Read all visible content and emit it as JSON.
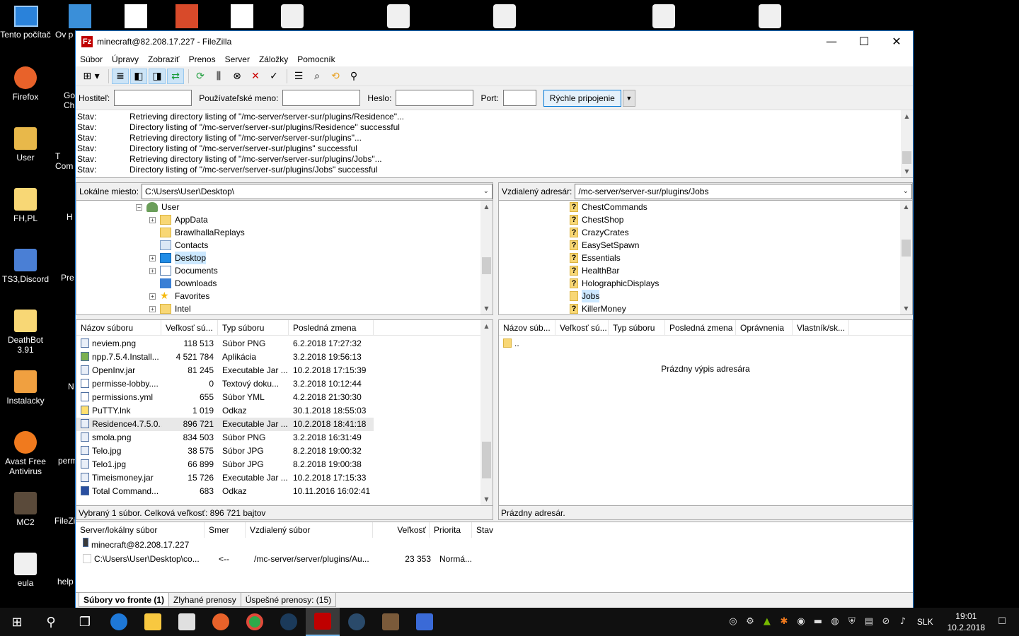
{
  "desktop": {
    "icons": [
      {
        "label": "Tento počítač",
        "color": "#4a90d9"
      },
      {
        "label": "Firefox",
        "color": "#e8622a"
      },
      {
        "label": "User",
        "color": "#e8b84a"
      },
      {
        "label": "FH,PL",
        "color": "#f8d775"
      },
      {
        "label": "TS3,Discord",
        "color": "#4a7fd5"
      },
      {
        "label": "DeathBot 3.91",
        "color": "#f8d775"
      },
      {
        "label": "Instalacky",
        "color": "#f0a040"
      },
      {
        "label": "Avast Free Antivirus",
        "color": "#f07a1e"
      },
      {
        "label": "MC2",
        "color": "#5a4a3a"
      },
      {
        "label": "eula",
        "color": "#f0f0f0"
      }
    ],
    "partial_labels": [
      "Ov p",
      "Go Ch",
      "T Com",
      "H",
      "Pre",
      "N",
      "perm",
      "FileZi",
      "help"
    ]
  },
  "window": {
    "title": "minecraft@82.208.17.227 - FileZilla",
    "app_icon": "Fz",
    "controls": {
      "minimize": "—",
      "maximize": "☐",
      "close": "✕"
    }
  },
  "menu": [
    "Súbor",
    "Úpravy",
    "Zobraziť",
    "Prenos",
    "Server",
    "Záložky",
    "Pomocník"
  ],
  "quickconnect": {
    "host_label": "Hostiteľ:",
    "user_label": "Používateľské meno:",
    "pass_label": "Heslo:",
    "port_label": "Port:",
    "host_value": "",
    "user_value": "",
    "pass_value": "",
    "port_value": "",
    "button": "Rýchle pripojenie",
    "dropdown": "▼"
  },
  "log": [
    {
      "status": "Stav:",
      "msg": "Retrieving directory listing of \"/mc-server/server-sur/plugins/Residence\"..."
    },
    {
      "status": "Stav:",
      "msg": "Directory listing of \"/mc-server/server-sur/plugins/Residence\" successful"
    },
    {
      "status": "Stav:",
      "msg": "Retrieving directory listing of \"/mc-server/server-sur/plugins\"..."
    },
    {
      "status": "Stav:",
      "msg": "Directory listing of \"/mc-server/server-sur/plugins\" successful"
    },
    {
      "status": "Stav:",
      "msg": "Retrieving directory listing of \"/mc-server/server-sur/plugins/Jobs\"..."
    },
    {
      "status": "Stav:",
      "msg": "Directory listing of \"/mc-server/server-sur/plugins/Jobs\" successful"
    }
  ],
  "local": {
    "path_label": "Lokálne miesto:",
    "path": "C:\\Users\\User\\Desktop\\",
    "tree": [
      {
        "label": "User",
        "indent": 0,
        "expander": "⊟",
        "icon": "user"
      },
      {
        "label": "AppData",
        "indent": 1,
        "expander": "+",
        "icon": "folder"
      },
      {
        "label": "BrawlhallaReplays",
        "indent": 1,
        "expander": "",
        "icon": "folder"
      },
      {
        "label": "Contacts",
        "indent": 1,
        "expander": "",
        "icon": "contacts"
      },
      {
        "label": "Desktop",
        "indent": 1,
        "expander": "+",
        "icon": "folder-blue"
      },
      {
        "label": "Documents",
        "indent": 1,
        "expander": "+",
        "icon": "docs"
      },
      {
        "label": "Downloads",
        "indent": 1,
        "expander": "",
        "icon": "down"
      },
      {
        "label": "Favorites",
        "indent": 1,
        "expander": "+",
        "icon": "star"
      },
      {
        "label": "Intel",
        "indent": 1,
        "expander": "+",
        "icon": "folder"
      }
    ],
    "columns": [
      "Názov súboru",
      "Veľkosť sú...",
      "Typ súboru",
      "Posledná zmena"
    ],
    "files": [
      {
        "name": "neviem.png",
        "size": "118 513",
        "type": "Súbor PNG",
        "modified": "6.2.2018 17:27:32"
      },
      {
        "name": "npp.7.5.4.Install...",
        "size": "4 521 784",
        "type": "Aplikácia",
        "modified": "3.2.2018 19:56:13"
      },
      {
        "name": "OpenInv.jar",
        "size": "81 245",
        "type": "Executable Jar ...",
        "modified": "10.2.2018 17:15:39"
      },
      {
        "name": "permisse-lobby....",
        "size": "0",
        "type": "Textový doku...",
        "modified": "3.2.2018 10:12:44"
      },
      {
        "name": "permissions.yml",
        "size": "655",
        "type": "Súbor YML",
        "modified": "4.2.2018 21:30:30"
      },
      {
        "name": "PuTTY.lnk",
        "size": "1 019",
        "type": "Odkaz",
        "modified": "30.1.2018 18:55:03"
      },
      {
        "name": "Residence4.7.5.0...",
        "size": "896 721",
        "type": "Executable Jar ...",
        "modified": "10.2.2018 18:41:18"
      },
      {
        "name": "smola.png",
        "size": "834 503",
        "type": "Súbor PNG",
        "modified": "3.2.2018 16:31:49"
      },
      {
        "name": "Telo.jpg",
        "size": "38 575",
        "type": "Súbor JPG",
        "modified": "8.2.2018 19:00:32"
      },
      {
        "name": "Telo1.jpg",
        "size": "66 899",
        "type": "Súbor JPG",
        "modified": "8.2.2018 19:00:38"
      },
      {
        "name": "Timeismoney.jar",
        "size": "15 726",
        "type": "Executable Jar ...",
        "modified": "10.2.2018 17:15:33"
      },
      {
        "name": "Total Command...",
        "size": "683",
        "type": "Odkaz",
        "modified": "10.11.2016 16:02:41"
      }
    ],
    "status": "Vybraný 1 súbor. Celková veľkosť: 896 721 bajtov"
  },
  "remote": {
    "path_label": "Vzdialený adresár:",
    "path": "/mc-server/server-sur/plugins/Jobs",
    "tree": [
      {
        "label": "ChestCommands",
        "icon": "q"
      },
      {
        "label": "ChestShop",
        "icon": "q"
      },
      {
        "label": "CrazyCrates",
        "icon": "q"
      },
      {
        "label": "EasySetSpawn",
        "icon": "q"
      },
      {
        "label": "Essentials",
        "icon": "q"
      },
      {
        "label": "HealthBar",
        "icon": "q"
      },
      {
        "label": "HolographicDisplays",
        "icon": "q"
      },
      {
        "label": "Jobs",
        "icon": "folder"
      },
      {
        "label": "KillerMoney",
        "icon": "q"
      }
    ],
    "columns": [
      "Názov súb...",
      "Veľkosť sú...",
      "Typ súboru",
      "Posledná zmena",
      "Oprávnenia",
      "Vlastník/sk..."
    ],
    "parent": "..",
    "empty_msg": "Prázdny výpis adresára",
    "status": "Prázdny adresár."
  },
  "queue": {
    "columns": [
      "Server/lokálny súbor",
      "Smer",
      "Vzdialený súbor",
      "Veľkosť",
      "Priorita",
      "Stav"
    ],
    "server": "minecraft@82.208.17.227",
    "item": {
      "local": "C:\\Users\\User\\Desktop\\co...",
      "dir": "<--",
      "remote": "/mc-server/server/plugins/Au...",
      "size": "23 353",
      "priority": "Normá..."
    }
  },
  "tabs": [
    "Súbory vo fronte (1)",
    "Zlyhané prenosy",
    "Úspešné prenosy: (15)"
  ],
  "taskbar": {
    "lang": "SLK",
    "time": "19:01",
    "date": "10.2.2018"
  },
  "colors": {
    "accent": "#1c79d4",
    "selection": "#cce8ff",
    "folder": "#f8d775"
  }
}
